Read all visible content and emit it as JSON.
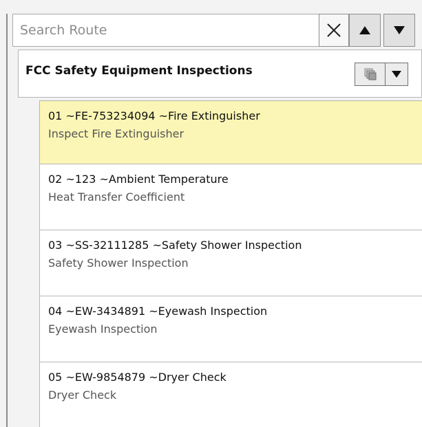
{
  "search": {
    "placeholder": "Search Route",
    "value": ""
  },
  "route": {
    "title": "FCC Safety Equipment Inspections"
  },
  "items": [
    {
      "title": "01 ~FE-753234094 ~Fire Extinguisher",
      "subtitle": "Inspect Fire Extinguisher",
      "selected": true
    },
    {
      "title": "02 ~123 ~Ambient Temperature",
      "subtitle": "Heat Transfer Coefficient",
      "selected": false
    },
    {
      "title": "03 ~SS-32111285 ~Safety Shower Inspection",
      "subtitle": "Safety Shower Inspection",
      "selected": false
    },
    {
      "title": "04 ~EW-3434891 ~Eyewash Inspection",
      "subtitle": "Eyewash Inspection",
      "selected": false
    },
    {
      "title": "05 ~EW-9854879 ~Dryer Check",
      "subtitle": "Dryer Check",
      "selected": false
    }
  ],
  "colors": {
    "selected_bg": "#fbf6b5",
    "subtitle_text": "#555555",
    "border": "#b4b4b4"
  }
}
